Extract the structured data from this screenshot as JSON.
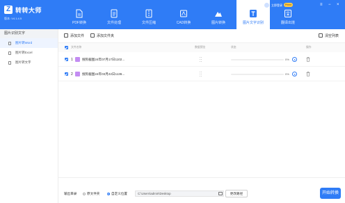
{
  "app": {
    "name": "转转大师",
    "version": "版本: V4.1.4.5"
  },
  "user": {
    "name": "立即登录",
    "vip": "Prime"
  },
  "tabs": [
    {
      "label": "PDF转换",
      "icon": "pdf-icon"
    },
    {
      "label": "文件处理",
      "icon": "file-process-icon"
    },
    {
      "label": "文件压缩",
      "icon": "compress-icon"
    },
    {
      "label": "CAD转换",
      "icon": "cad-icon"
    },
    {
      "label": "图片转换",
      "icon": "image-convert-icon"
    },
    {
      "label": "图片文字识别",
      "icon": "ocr-text-icon",
      "active": true
    },
    {
      "label": "翻译出境",
      "icon": "translate-icon"
    }
  ],
  "sidebar": {
    "title": "图片识别文字",
    "items": [
      {
        "label": "图片转Word",
        "active": true
      },
      {
        "label": "图片转Excel"
      },
      {
        "label": "图片转文字"
      }
    ]
  },
  "toolbar": {
    "add_file": "添加文件",
    "add_folder": "添加文件夹",
    "clear_list": "清空列表"
  },
  "table": {
    "headers": [
      "文件名称",
      "数据预览",
      "状态",
      "操作"
    ],
    "rows": [
      {
        "index": "1",
        "name": "搜狗截图24年07月17日1102...",
        "progress": 0,
        "pct": "0%"
      },
      {
        "index": "2",
        "name": "搜狗截图24年03月22日1136...",
        "progress": 0,
        "pct": "0%"
      }
    ]
  },
  "output": {
    "label": "输出目录",
    "options": [
      {
        "label": "原文件夹",
        "selected": false
      },
      {
        "label": "自定义位置",
        "selected": true
      }
    ],
    "path": "C:\\Users\\admin\\Desktop",
    "change_label": "更改路径",
    "convert_label": "开始转换"
  },
  "colors": {
    "brand": "#2f7cf6",
    "vip": "#ffcc48",
    "file_icon": "#c38cf2"
  }
}
